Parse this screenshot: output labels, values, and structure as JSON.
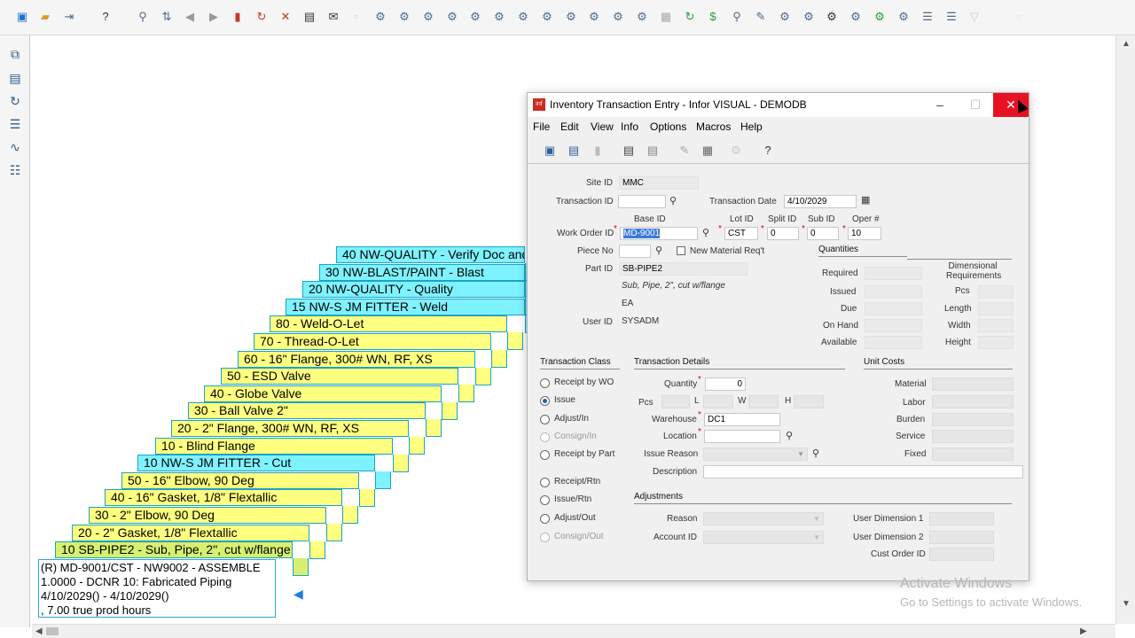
{
  "toolbar": {
    "icons": [
      "new-icon",
      "open-icon",
      "save-as-icon",
      "help-icon",
      "search-icon",
      "link-icon",
      "prev-icon",
      "next-icon",
      "delete-icon",
      "refresh-icon",
      "cancel-icon",
      "print-icon",
      "email-icon"
    ]
  },
  "diagram": {
    "cards": [
      {
        "label": "40 NW-QUALITY -  Verify Doc and",
        "color": "cyan"
      },
      {
        "label": "30 NW-BLAST/PAINT -  Blast",
        "color": "cyan"
      },
      {
        "label": "20 NW-QUALITY -  Quality",
        "color": "cyan"
      },
      {
        "label": "15 NW-S JM FITTER -  Weld",
        "color": "cyan"
      },
      {
        "label": "80  - Weld-O-Let",
        "color": "yellow"
      },
      {
        "label": "70  - Thread-O-Let",
        "color": "yellow"
      },
      {
        "label": "60  - 16\" Flange, 300# WN, RF, XS",
        "color": "yellow"
      },
      {
        "label": "50  - ESD Valve",
        "color": "yellow"
      },
      {
        "label": "40  - Globe Valve",
        "color": "yellow"
      },
      {
        "label": "30  - Ball Valve 2\"",
        "color": "yellow"
      },
      {
        "label": "20  - 2\" Flange, 300# WN, RF, XS",
        "color": "yellow"
      },
      {
        "label": "10  - Blind Flange",
        "color": "yellow"
      },
      {
        "label": "10 NW-S JM FITTER -  Cut",
        "color": "cyan"
      },
      {
        "label": "50  - 16\" Elbow, 90 Deg",
        "color": "yellow"
      },
      {
        "label": "40  - 16\" Gasket, 1/8\" Flextallic",
        "color": "yellow"
      },
      {
        "label": "30  - 2\" Elbow, 90 Deg",
        "color": "yellow"
      },
      {
        "label": "20  - 2\" Gasket, 1/8\" Flextallic",
        "color": "yellow"
      },
      {
        "label": "10 SB-PIPE2 - Sub, Pipe, 2\", cut w/flange",
        "color": "green"
      }
    ],
    "info": {
      "line1": "(R) MD-9001/CST - NW9002 - ASSEMBLE",
      "line2": "1.0000 - DCNR 10: Fabricated Piping",
      "line3": "4/10/2029() - 4/10/2029()",
      "line4": ", 7.00 true prod hours"
    }
  },
  "window": {
    "title": "Inventory Transaction Entry - Infor VISUAL - DEMODB",
    "menu": [
      "File",
      "Edit",
      "View",
      "Info",
      "Options",
      "Macros",
      "Help"
    ],
    "labels": {
      "site_id": "Site ID",
      "transaction_id": "Transaction ID",
      "transaction_date": "Transaction Date",
      "base_id": "Base ID",
      "lot_id": "Lot ID",
      "split_id": "Split ID",
      "sub_id": "Sub ID",
      "oper": "Oper #",
      "work_order_id": "Work Order ID",
      "piece_no": "Piece No",
      "new_material_reqt": "New Material Req't",
      "part_id": "Part ID",
      "user_id": "User ID",
      "quantities": "Quantities",
      "dimensional": "Dimensional Requirements",
      "required": "Required",
      "issued": "Issued",
      "due": "Due",
      "on_hand": "On Hand",
      "available": "Available",
      "pcs": "Pcs",
      "length": "Length",
      "width": "Width",
      "height": "Height",
      "transaction_class": "Transaction Class",
      "transaction_details": "Transaction Details",
      "unit_costs": "Unit Costs",
      "quantity": "Quantity",
      "pcs2": "Pcs",
      "l": "L",
      "w": "W",
      "h": "H",
      "warehouse": "Warehouse",
      "location": "Location",
      "issue_reason": "Issue Reason",
      "description": "Description",
      "adjustments": "Adjustments",
      "reason": "Reason",
      "account_id": "Account ID",
      "material": "Material",
      "labor": "Labor",
      "burden": "Burden",
      "service": "Service",
      "fixed": "Fixed",
      "user_dim1": "User Dimension 1",
      "user_dim2": "User Dimension 2",
      "cust_order_id": "Cust Order ID"
    },
    "values": {
      "site_id": "MMC",
      "transaction_date": "4/10/2029",
      "base_id": "MD-9001",
      "lot_id": "CST",
      "split_id": "0",
      "sub_id": "0",
      "oper": "10",
      "part_id": "SB-PIPE2",
      "part_desc": "Sub, Pipe, 2\", cut w/flange",
      "uom": "EA",
      "user_id": "SYSADM",
      "quantity": "0",
      "warehouse": "DC1"
    },
    "transaction_classes": [
      {
        "label": "Receipt by WO",
        "checked": false,
        "enabled": true
      },
      {
        "label": "Issue",
        "checked": true,
        "enabled": true
      },
      {
        "label": "Adjust/In",
        "checked": false,
        "enabled": true
      },
      {
        "label": "Consign/In",
        "checked": false,
        "enabled": false
      },
      {
        "label": "Receipt by Part",
        "checked": false,
        "enabled": true
      },
      {
        "label": "Receipt/Rtn",
        "checked": false,
        "enabled": true
      },
      {
        "label": "Issue/Rtn",
        "checked": false,
        "enabled": true
      },
      {
        "label": "Adjust/Out",
        "checked": false,
        "enabled": true
      },
      {
        "label": "Consign/Out",
        "checked": false,
        "enabled": false
      }
    ]
  },
  "watermark": {
    "line1": "Activate Windows",
    "line2": "Go to Settings to activate Windows."
  }
}
